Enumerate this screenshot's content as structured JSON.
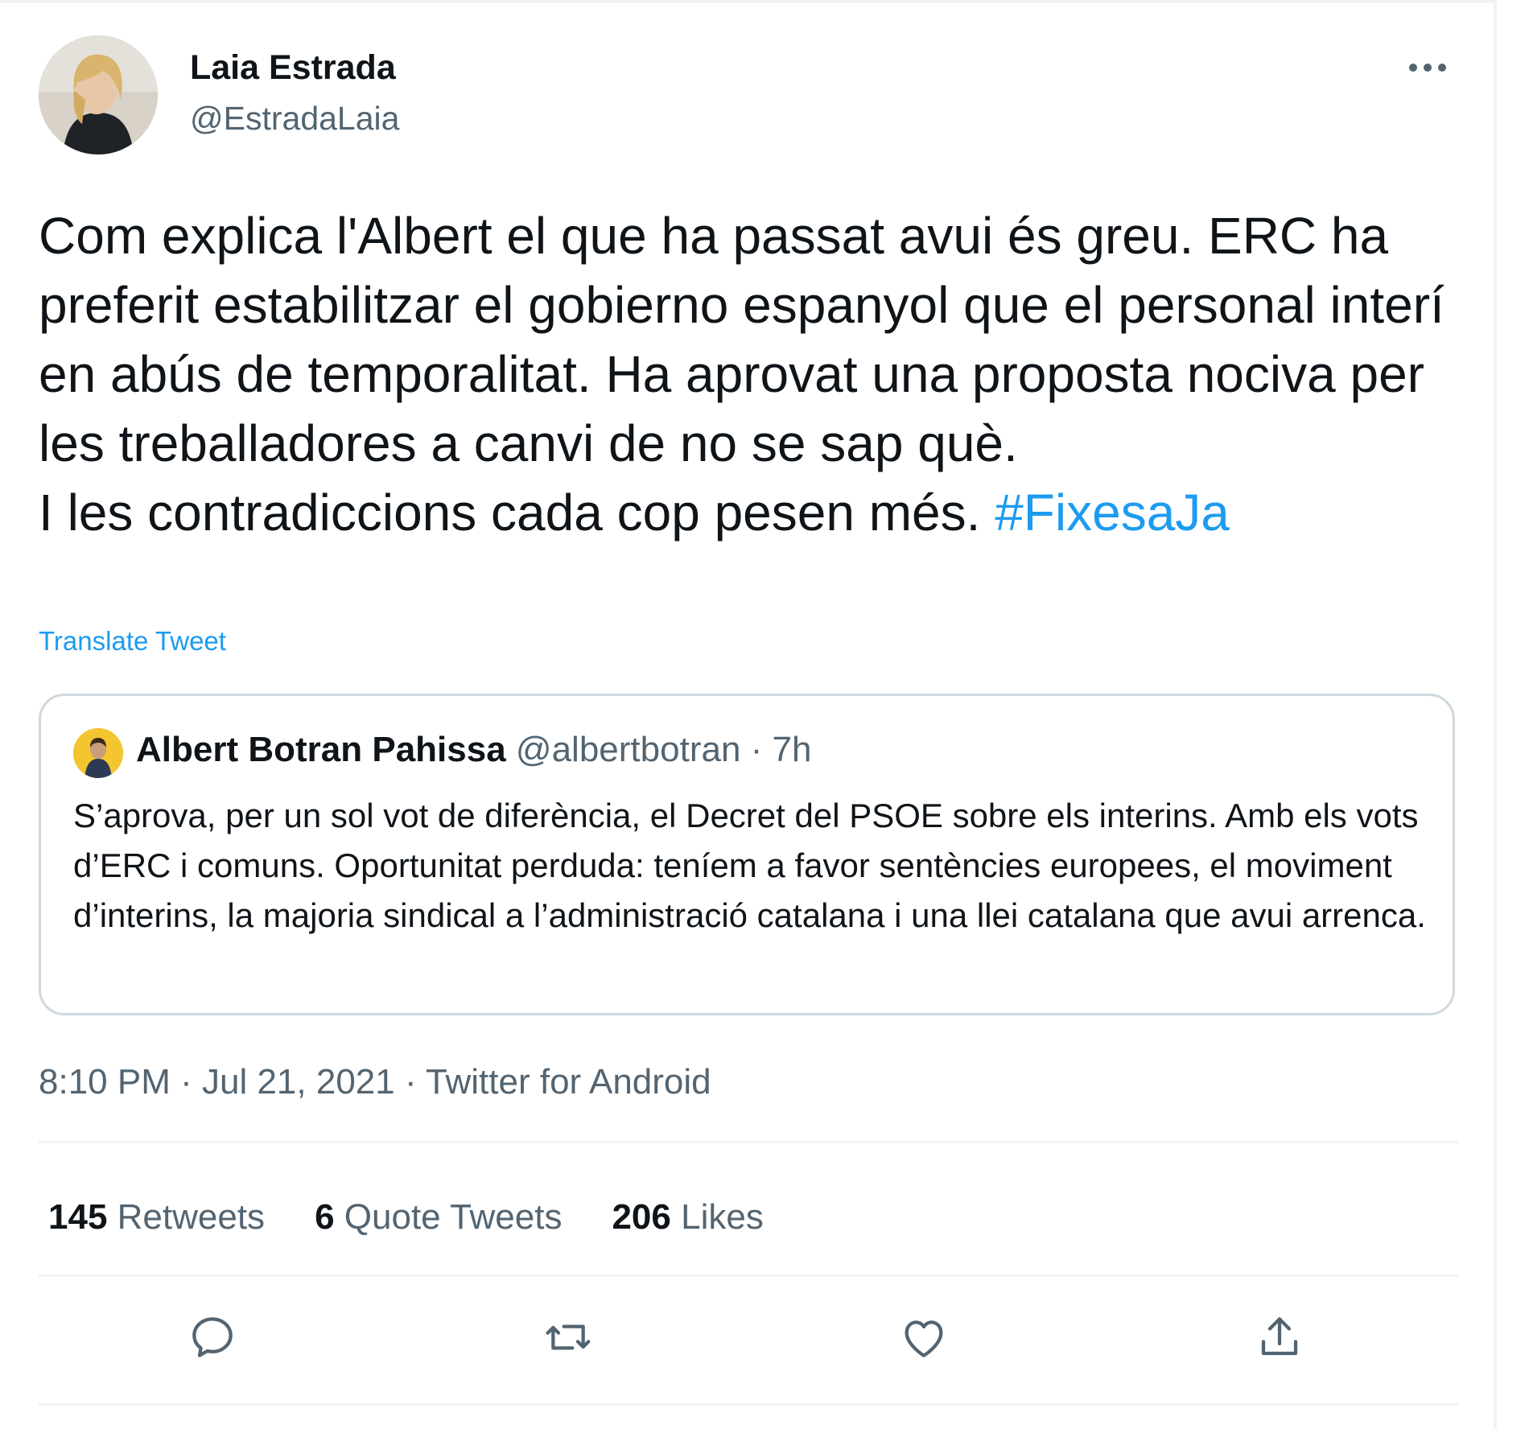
{
  "author": {
    "name": "Laia Estrada",
    "handle": "@EstradaLaia"
  },
  "tweet": {
    "text": "Com explica l'Albert el que ha passat avui és greu. ERC ha preferit estabilitzar el gobierno espanyol que el personal interí en abús de temporalitat. Ha aprovat una proposta nociva per les treballadores a canvi de no se sap què.\nI les contradiccions cada cop pesen més. ",
    "hashtag": "#FixesaJa",
    "translate_label": "Translate Tweet"
  },
  "quote": {
    "name": "Albert Botran Pahissa",
    "handle": "@albertbotran",
    "separator": " · ",
    "time": "7h",
    "text": "S’aprova, per un sol vot de diferència, el Decret del PSOE sobre els interins. Amb els vots d’ERC i comuns. Oportunitat perduda: teníem a favor sentències europees, el moviment d’interins, la majoria sindical a l’administració catalana i una llei catalana que avui arrenca."
  },
  "meta": {
    "time": "8:10 PM",
    "separator": " · ",
    "date": "Jul 21, 2021",
    "source": "Twitter for Android"
  },
  "stats": {
    "retweets_count": "145",
    "retweets_label": " Retweets",
    "quotes_count": "6",
    "quotes_label": " Quote Tweets",
    "likes_count": "206",
    "likes_label": " Likes"
  },
  "actions": [
    "reply-icon",
    "retweet-icon",
    "like-icon",
    "share-icon"
  ],
  "colors": {
    "accent": "#1d9bf0",
    "secondary_text": "#536471",
    "primary_text": "#0f1419",
    "border": "#cfd9de"
  }
}
